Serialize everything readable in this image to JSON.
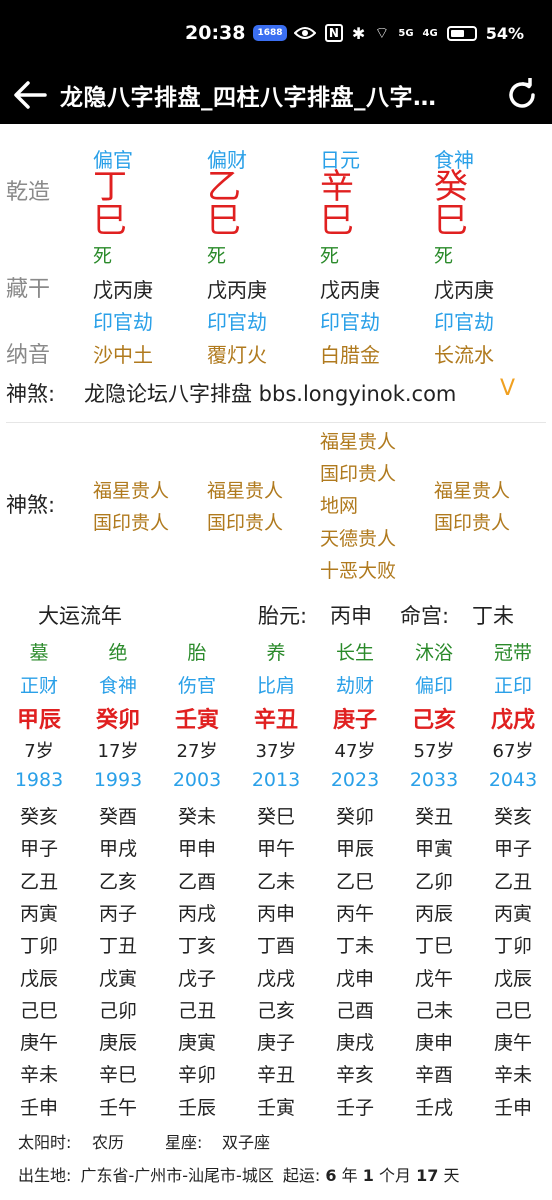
{
  "status_bar": {
    "time": "20:38",
    "badge": "1688",
    "nfc": "N",
    "bt": "✱",
    "wifi": "⌔",
    "sig1": "5G",
    "sig2": "4G",
    "battery": "54%"
  },
  "app_bar": {
    "title": "龙隐八字排盘_四柱八字排盘_八字…",
    "back_icon": "arrow-left-icon",
    "refresh_icon": "refresh-icon"
  },
  "chart": {
    "label_qianzao": "乾造",
    "label_canggan": "藏干",
    "label_nayin": "纳音",
    "pillars": [
      {
        "shishen": "偏官",
        "gan": "丁",
        "zhi": "巳",
        "state": "死",
        "canggan": "戊丙庚",
        "cg_shishen": "印官劫",
        "nayin": "沙中土"
      },
      {
        "shishen": "偏财",
        "gan": "乙",
        "zhi": "巳",
        "state": "死",
        "canggan": "戊丙庚",
        "cg_shishen": "印官劫",
        "nayin": "覆灯火"
      },
      {
        "shishen": "日元",
        "gan": "辛",
        "zhi": "巳",
        "state": "死",
        "canggan": "戊丙庚",
        "cg_shishen": "印官劫",
        "nayin": "白腊金"
      },
      {
        "shishen": "食神",
        "gan": "癸",
        "zhi": "巳",
        "state": "死",
        "canggan": "戊丙庚",
        "cg_shishen": "印官劫",
        "nayin": "长流水"
      }
    ],
    "shensha_line_label": "神煞:",
    "shensha_line_text": "龙隐论坛八字排盘 bbs.longyinok.com",
    "shensha_line_chevron": "V",
    "shensha_label": "神煞:",
    "shensha": [
      [
        "福星贵人",
        "国印贵人"
      ],
      [
        "福星贵人",
        "国印贵人"
      ],
      [
        "福星贵人",
        "国印贵人",
        "地网",
        "天德贵人",
        "十恶大败"
      ],
      [
        "福星贵人",
        "国印贵人"
      ]
    ]
  },
  "dayun": {
    "title": "大运流年",
    "taiyuan_label": "胎元:",
    "taiyuan": "丙申",
    "minggong_label": "命宫:",
    "minggong": "丁未",
    "columns": [
      {
        "state": "墓",
        "shishen": "正财",
        "ganzhi": "甲辰",
        "age": "7岁",
        "year": "1983",
        "years": [
          "癸亥",
          "甲子",
          "乙丑",
          "丙寅",
          "丁卯",
          "戊辰",
          "己巳",
          "庚午",
          "辛未",
          "壬申"
        ]
      },
      {
        "state": "绝",
        "shishen": "食神",
        "ganzhi": "癸卯",
        "age": "17岁",
        "year": "1993",
        "years": [
          "癸酉",
          "甲戌",
          "乙亥",
          "丙子",
          "丁丑",
          "戊寅",
          "己卯",
          "庚辰",
          "辛巳",
          "壬午"
        ]
      },
      {
        "state": "胎",
        "shishen": "伤官",
        "ganzhi": "壬寅",
        "age": "27岁",
        "year": "2003",
        "years": [
          "癸未",
          "甲申",
          "乙酉",
          "丙戌",
          "丁亥",
          "戊子",
          "己丑",
          "庚寅",
          "辛卯",
          "壬辰"
        ]
      },
      {
        "state": "养",
        "shishen": "比肩",
        "ganzhi": "辛丑",
        "age": "37岁",
        "year": "2013",
        "years": [
          "癸巳",
          "甲午",
          "乙未",
          "丙申",
          "丁酉",
          "戊戌",
          "己亥",
          "庚子",
          "辛丑",
          "壬寅"
        ]
      },
      {
        "state": "长生",
        "shishen": "劫财",
        "ganzhi": "庚子",
        "age": "47岁",
        "year": "2023",
        "years": [
          "癸卯",
          "甲辰",
          "乙巳",
          "丙午",
          "丁未",
          "戊申",
          "己酉",
          "庚戌",
          "辛亥",
          "壬子"
        ]
      },
      {
        "state": "沐浴",
        "shishen": "偏印",
        "ganzhi": "己亥",
        "age": "57岁",
        "year": "2033",
        "years": [
          "癸丑",
          "甲寅",
          "乙卯",
          "丙辰",
          "丁巳",
          "戊午",
          "己未",
          "庚申",
          "辛酉",
          "壬戌"
        ]
      },
      {
        "state": "冠带",
        "shishen": "正印",
        "ganzhi": "戊戌",
        "age": "67岁",
        "year": "2043",
        "years": [
          "癸亥",
          "甲子",
          "乙丑",
          "丙寅",
          "丁卯",
          "戊辰",
          "己巳",
          "庚午",
          "辛未",
          "壬申"
        ]
      }
    ]
  },
  "info": {
    "solar_label": "太阳时:",
    "calendar": "农历",
    "zodiac_label": "星座:",
    "zodiac": "双子座",
    "birthplace_label": "出生地:",
    "birthplace": "广东省-广州市-汕尾市-城区",
    "qiyun_label": "起运:",
    "qiyun_y": "6",
    "qiyun_y_unit": "年",
    "qiyun_m": "1",
    "qiyun_m_unit": "个月",
    "qiyun_d": "17",
    "qiyun_d_unit": "天"
  }
}
